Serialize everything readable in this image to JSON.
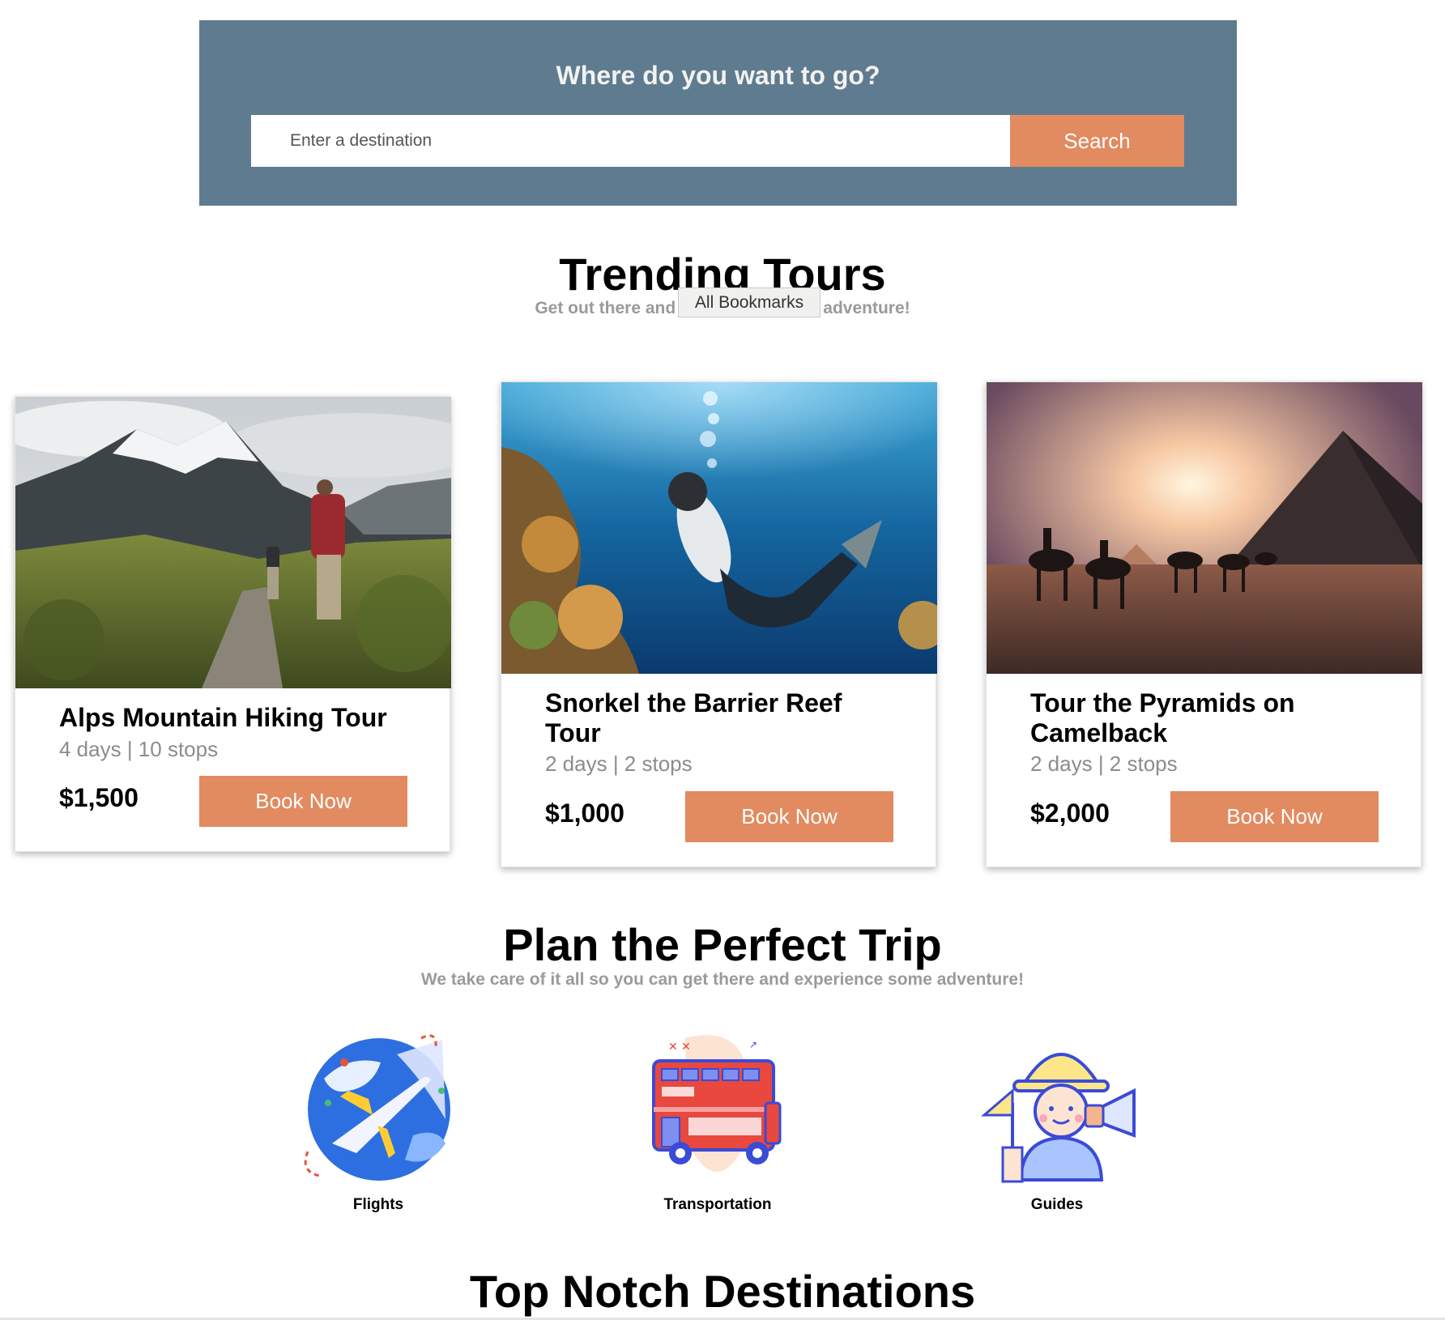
{
  "search": {
    "title": "Where do you want to go?",
    "placeholder": "Enter a destination",
    "button_label": "Search"
  },
  "trending": {
    "title": "Trending Tours",
    "subtitle": "Get out there and experience some adventure!",
    "tooltip": "All Bookmarks",
    "tours": [
      {
        "title": "Alps Mountain Hiking Tour",
        "meta": "4 days | 10 stops",
        "price": "$1,500",
        "button": "Book Now",
        "image": "mountain-hikers-photo"
      },
      {
        "title": "Snorkel the Barrier Reef Tour",
        "meta": "2 days | 2 stops",
        "price": "$1,000",
        "button": "Book Now",
        "image": "snorkel-diver-photo"
      },
      {
        "title": "Tour the Pyramids on Camelback",
        "meta": "2 days | 2 stops",
        "price": "$2,000",
        "button": "Book Now",
        "image": "pyramids-camels-photo"
      }
    ]
  },
  "plan": {
    "title": "Plan the Perfect Trip",
    "subtitle": "We take care of it all so you can get there and experience some adventure!",
    "services": [
      {
        "label": "Flights",
        "icon": "airplane-globe-icon"
      },
      {
        "label": "Transportation",
        "icon": "double-decker-bus-icon"
      },
      {
        "label": "Guides",
        "icon": "tour-guide-icon"
      }
    ]
  },
  "destinations": {
    "title": "Top Notch Destinations"
  },
  "colors": {
    "banner": "#5f7b8f",
    "accent": "#e28a60",
    "muted_text": "#9a9a9a"
  }
}
